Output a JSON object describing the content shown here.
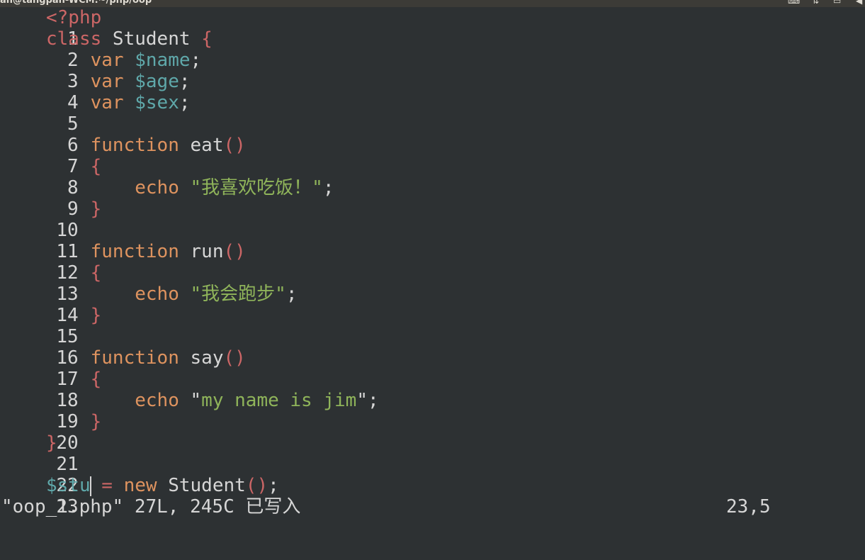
{
  "titlebar": {
    "title": "an@tangpan-WCM:~/php/oop"
  },
  "editor": {
    "lines": [
      {
        "n": "1"
      },
      {
        "n": "2"
      },
      {
        "n": "3"
      },
      {
        "n": "4"
      },
      {
        "n": "5"
      },
      {
        "n": "6"
      },
      {
        "n": "7"
      },
      {
        "n": "8"
      },
      {
        "n": "9"
      },
      {
        "n": "10"
      },
      {
        "n": "11"
      },
      {
        "n": "12"
      },
      {
        "n": "13"
      },
      {
        "n": "14"
      },
      {
        "n": "15"
      },
      {
        "n": "16"
      },
      {
        "n": "17"
      },
      {
        "n": "18"
      },
      {
        "n": "19"
      },
      {
        "n": "20"
      },
      {
        "n": "21"
      },
      {
        "n": "22"
      },
      {
        "n": "23"
      }
    ],
    "code": {
      "l1_open": "<?php",
      "l2_class": "class",
      "l2_name": " Student ",
      "l2_brace": "{",
      "var_kw": "var",
      "l3_var": "$name",
      "l4_var": "$age",
      "l5_var": "$sex",
      "semi": ";",
      "function_kw": "function",
      "l7_fn": " eat",
      "parens": "()",
      "open_brace": "{",
      "close_brace": "}",
      "echo_kw": "echo",
      "l9_str": "\"我喜欢吃饭！\"",
      "l12_fn": " run",
      "l14_str": "\"我会跑步\"",
      "l17_fn": " say",
      "l19_str_open": "\"",
      "l19_str": "my name is jim",
      "l19_str_close": "\"",
      "l23_var_a": "$stu",
      "l23_eq": " = ",
      "l23_new": "new",
      "l23_cls": " Student"
    }
  },
  "status": {
    "message": "\"oop_1.php\" 27L, 245C 已写入",
    "position": "23,5"
  },
  "colors": {
    "background": "#2d3133",
    "keyword_red": "#cc6666",
    "keyword_orange": "#de935f",
    "variable": "#5fa8aa",
    "string": "#8fb45a",
    "text": "#d6d6d6"
  }
}
